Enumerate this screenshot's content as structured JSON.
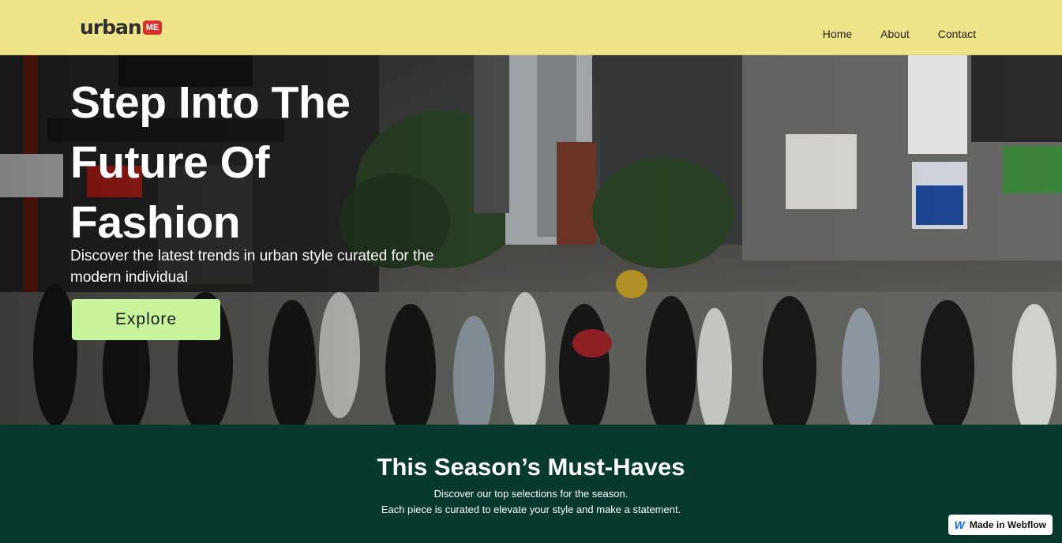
{
  "header": {
    "logo_text": "urban",
    "logo_badge": "ME",
    "nav": [
      {
        "label": "Home"
      },
      {
        "label": "About"
      },
      {
        "label": "Contact"
      }
    ]
  },
  "hero": {
    "title": "Step Into The Future Of Fashion",
    "subtitle": "Discover the latest trends in urban style curated for the modern individual",
    "cta_label": "Explore"
  },
  "section": {
    "title": "This Season’s Must-Haves",
    "line1": "Discover our top selections for the season.",
    "line2": "Each piece is curated to elevate your style and make a statement."
  },
  "badge": {
    "label": "Made in Webflow",
    "icon": "webflow-icon"
  },
  "colors": {
    "navbar_bg": "#f0e48a",
    "cta_bg": "#c8f59c",
    "section_bg": "#07392f",
    "logo_badge": "#d4312b"
  }
}
